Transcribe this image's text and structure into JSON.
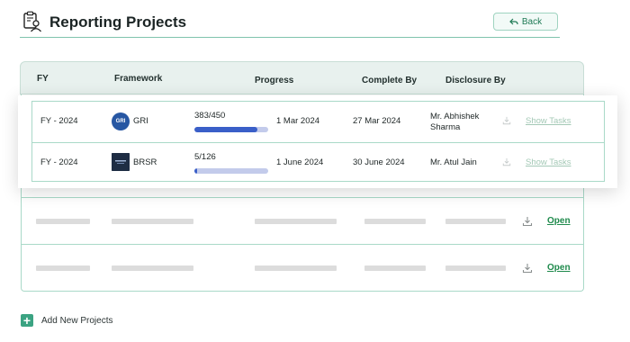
{
  "header": {
    "title": "Reporting Projects",
    "back_label": "Back"
  },
  "table": {
    "columns": [
      "FY",
      "Framework",
      "Progress",
      "Complete By",
      "Disclosure By"
    ],
    "rows": [
      {
        "fy": "FY - 2024",
        "framework": "GRI",
        "framework_logo_text": "GRI",
        "progress_text": "383/450",
        "progress_fraction": 0.851,
        "start": "1 Mar 2024",
        "complete_by": "27 Mar 2024",
        "disclosure_by_line1": "Mr. Abhishek",
        "disclosure_by_line2": "Sharma",
        "action": "Show Tasks"
      },
      {
        "fy": "FY - 2024",
        "framework": "BRSR",
        "progress_text": "5/126",
        "progress_fraction": 0.04,
        "start": "1 June 2024",
        "complete_by": "30 June 2024",
        "disclosure_by_line1": "Mr. Atul Jain",
        "disclosure_by_line2": "",
        "action": "Show Tasks"
      }
    ],
    "placeholder_rows": [
      {
        "action": "Open"
      },
      {
        "action": "Open"
      }
    ]
  },
  "footer": {
    "add_label": "Add New Projects"
  },
  "colors": {
    "accent": "#3ba382",
    "progress_fill": "#3a5fc8",
    "progress_track": "#c3cbeb",
    "link": "#1f8a4c",
    "border": "#a9d9c8"
  },
  "icons": {
    "header": "report-user-icon",
    "back": "back-arrow-icon",
    "download": "download-icon",
    "add": "plus-icon"
  }
}
